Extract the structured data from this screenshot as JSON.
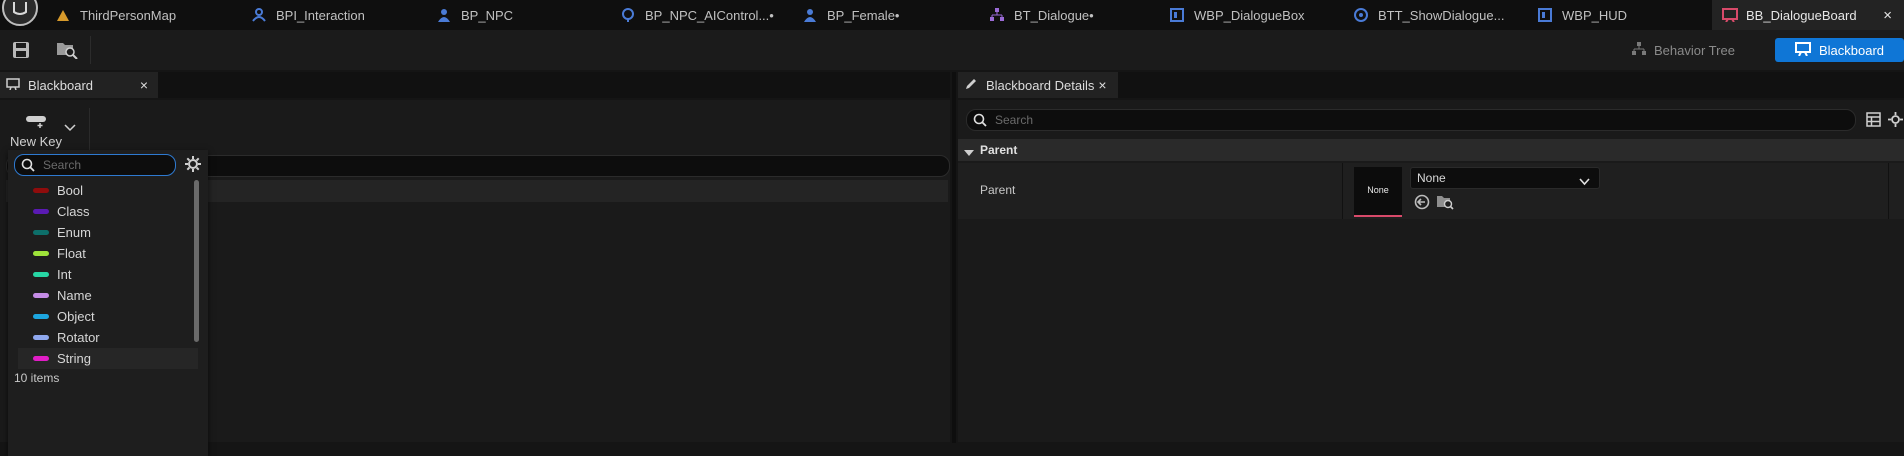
{
  "tabs": [
    {
      "label": "ThirdPersonMap",
      "icon": "level-icon",
      "color": "#d79a2b"
    },
    {
      "label": "BPI_Interaction",
      "icon": "interface-icon",
      "color": "#4a7bd6"
    },
    {
      "label": "BP_NPC",
      "icon": "character-icon",
      "color": "#4a7bd6"
    },
    {
      "label": "BP_NPC_AIControl...•",
      "icon": "ai-controller-icon",
      "color": "#4a7bd6"
    },
    {
      "label": "BP_Female•",
      "icon": "character-icon",
      "color": "#4a7bd6"
    },
    {
      "label": "BT_Dialogue•",
      "icon": "behavior-tree-icon",
      "color": "#9a6ad6"
    },
    {
      "label": "WBP_DialogueBox",
      "icon": "widget-icon",
      "color": "#4a7bd6"
    },
    {
      "label": "BTT_ShowDialogue...",
      "icon": "task-icon",
      "color": "#4a7bd6"
    },
    {
      "label": "WBP_HUD",
      "icon": "widget-icon",
      "color": "#4a7bd6"
    },
    {
      "label": "BB_DialogueBoard",
      "icon": "blackboard-icon",
      "color": "#d84a6a",
      "active": true
    }
  ],
  "toolbar": {
    "behavior_tree_label": "Behavior Tree",
    "blackboard_label": "Blackboard"
  },
  "left_panel": {
    "tab_label": "Blackboard",
    "new_key_label": "New Key",
    "search_placeholder": "Search",
    "items_count": "10 items",
    "key_types": [
      {
        "label": "Bool",
        "color": "#8f0c0c"
      },
      {
        "label": "Class",
        "color": "#5a1ab3"
      },
      {
        "label": "Enum",
        "color": "#0d6f6a"
      },
      {
        "label": "Float",
        "color": "#9ee33a"
      },
      {
        "label": "Int",
        "color": "#27d6a4"
      },
      {
        "label": "Name",
        "color": "#c58ce6"
      },
      {
        "label": "Object",
        "color": "#1da6df"
      },
      {
        "label": "Rotator",
        "color": "#8fa8ee"
      },
      {
        "label": "String",
        "color": "#e11dc6"
      }
    ]
  },
  "right_panel": {
    "tab_label": "Blackboard Details",
    "search_placeholder": "Search",
    "section_label": "Parent",
    "property_label": "Parent",
    "thumbnail_label": "None",
    "combo_value": "None"
  }
}
